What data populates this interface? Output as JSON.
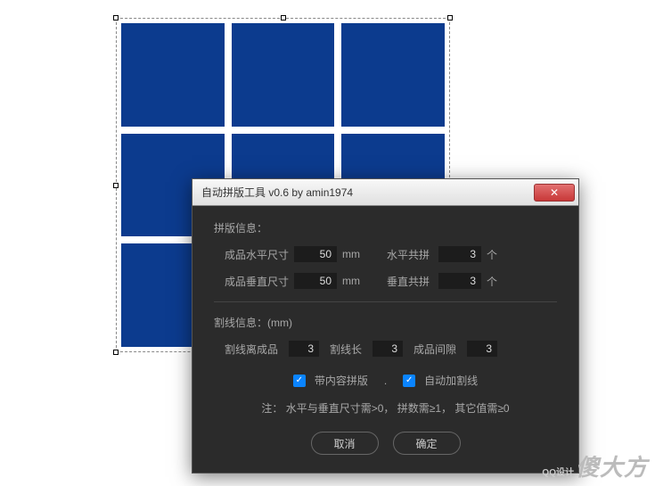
{
  "dialog": {
    "title": "自动拼版工具 v0.6   by amin1974",
    "section_layout": "拼版信息：",
    "width_label": "成品水平尺寸",
    "width_value": "50",
    "height_label": "成品垂直尺寸",
    "height_value": "50",
    "unit_mm": "mm",
    "h_count_label": "水平共拼",
    "h_count_value": "3",
    "v_count_label": "垂直共拼",
    "v_count_value": "3",
    "unit_count": "个",
    "section_cut": "割线信息：(mm)",
    "cut_offset_label": "割线离成品",
    "cut_offset_value": "3",
    "cut_len_label": "割线长",
    "cut_len_value": "3",
    "gap_label": "成品间隙",
    "gap_value": "3",
    "chk_with_content": "带内容拼版",
    "chk_auto_cut": "自动加割线",
    "note": "注： 水平与垂直尺寸需>0， 拼数需≥1， 其它值需≥0",
    "cancel": "取消",
    "ok": "确定"
  },
  "watermark": {
    "small": "QQ设计",
    "big": "傻大方"
  }
}
